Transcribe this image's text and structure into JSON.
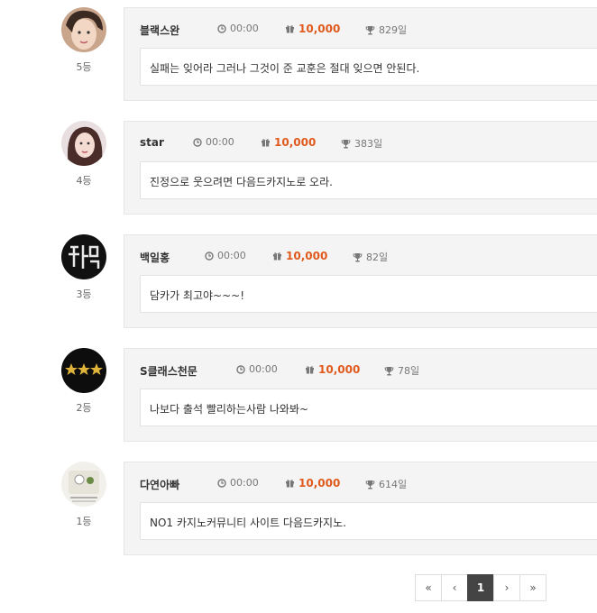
{
  "entries": [
    {
      "name": "블랙스완",
      "time": "00:00",
      "points": "10,000",
      "days": "829일",
      "rank": "5등",
      "message": "실패는 잊어라 그러나 그것이 준 교훈은 절대 잊으면 안된다.",
      "avatar": "woman-photo"
    },
    {
      "name": "star",
      "time": "00:00",
      "points": "10,000",
      "days": "383일",
      "rank": "4등",
      "message": "진정으로 웃으려면 다음드카지노로 오라.",
      "avatar": "woman-photo"
    },
    {
      "name": "백일홍",
      "time": "00:00",
      "points": "10,000",
      "days": "82일",
      "rank": "3등",
      "message": "담카가 최고야~~~!",
      "avatar": "neon-sign"
    },
    {
      "name": "S클래스천문",
      "time": "00:00",
      "points": "10,000",
      "days": "78일",
      "rank": "2등",
      "message": "나보다 출석 빨리하는사람 나와봐~",
      "avatar": "three-stars"
    },
    {
      "name": "다연아빠",
      "time": "00:00",
      "points": "10,000",
      "days": "614일",
      "rank": "1등",
      "message": "NO1 카지노커뮤니티 사이트 다음드카지노.",
      "avatar": "cartoon-drawing"
    }
  ],
  "pagination": {
    "first": "«",
    "prev": "‹",
    "current": "1",
    "next": "›",
    "last": "»"
  },
  "colors": {
    "points": "#e05a1e",
    "card_bg": "#f4f4f4",
    "active_page": "#444444"
  }
}
